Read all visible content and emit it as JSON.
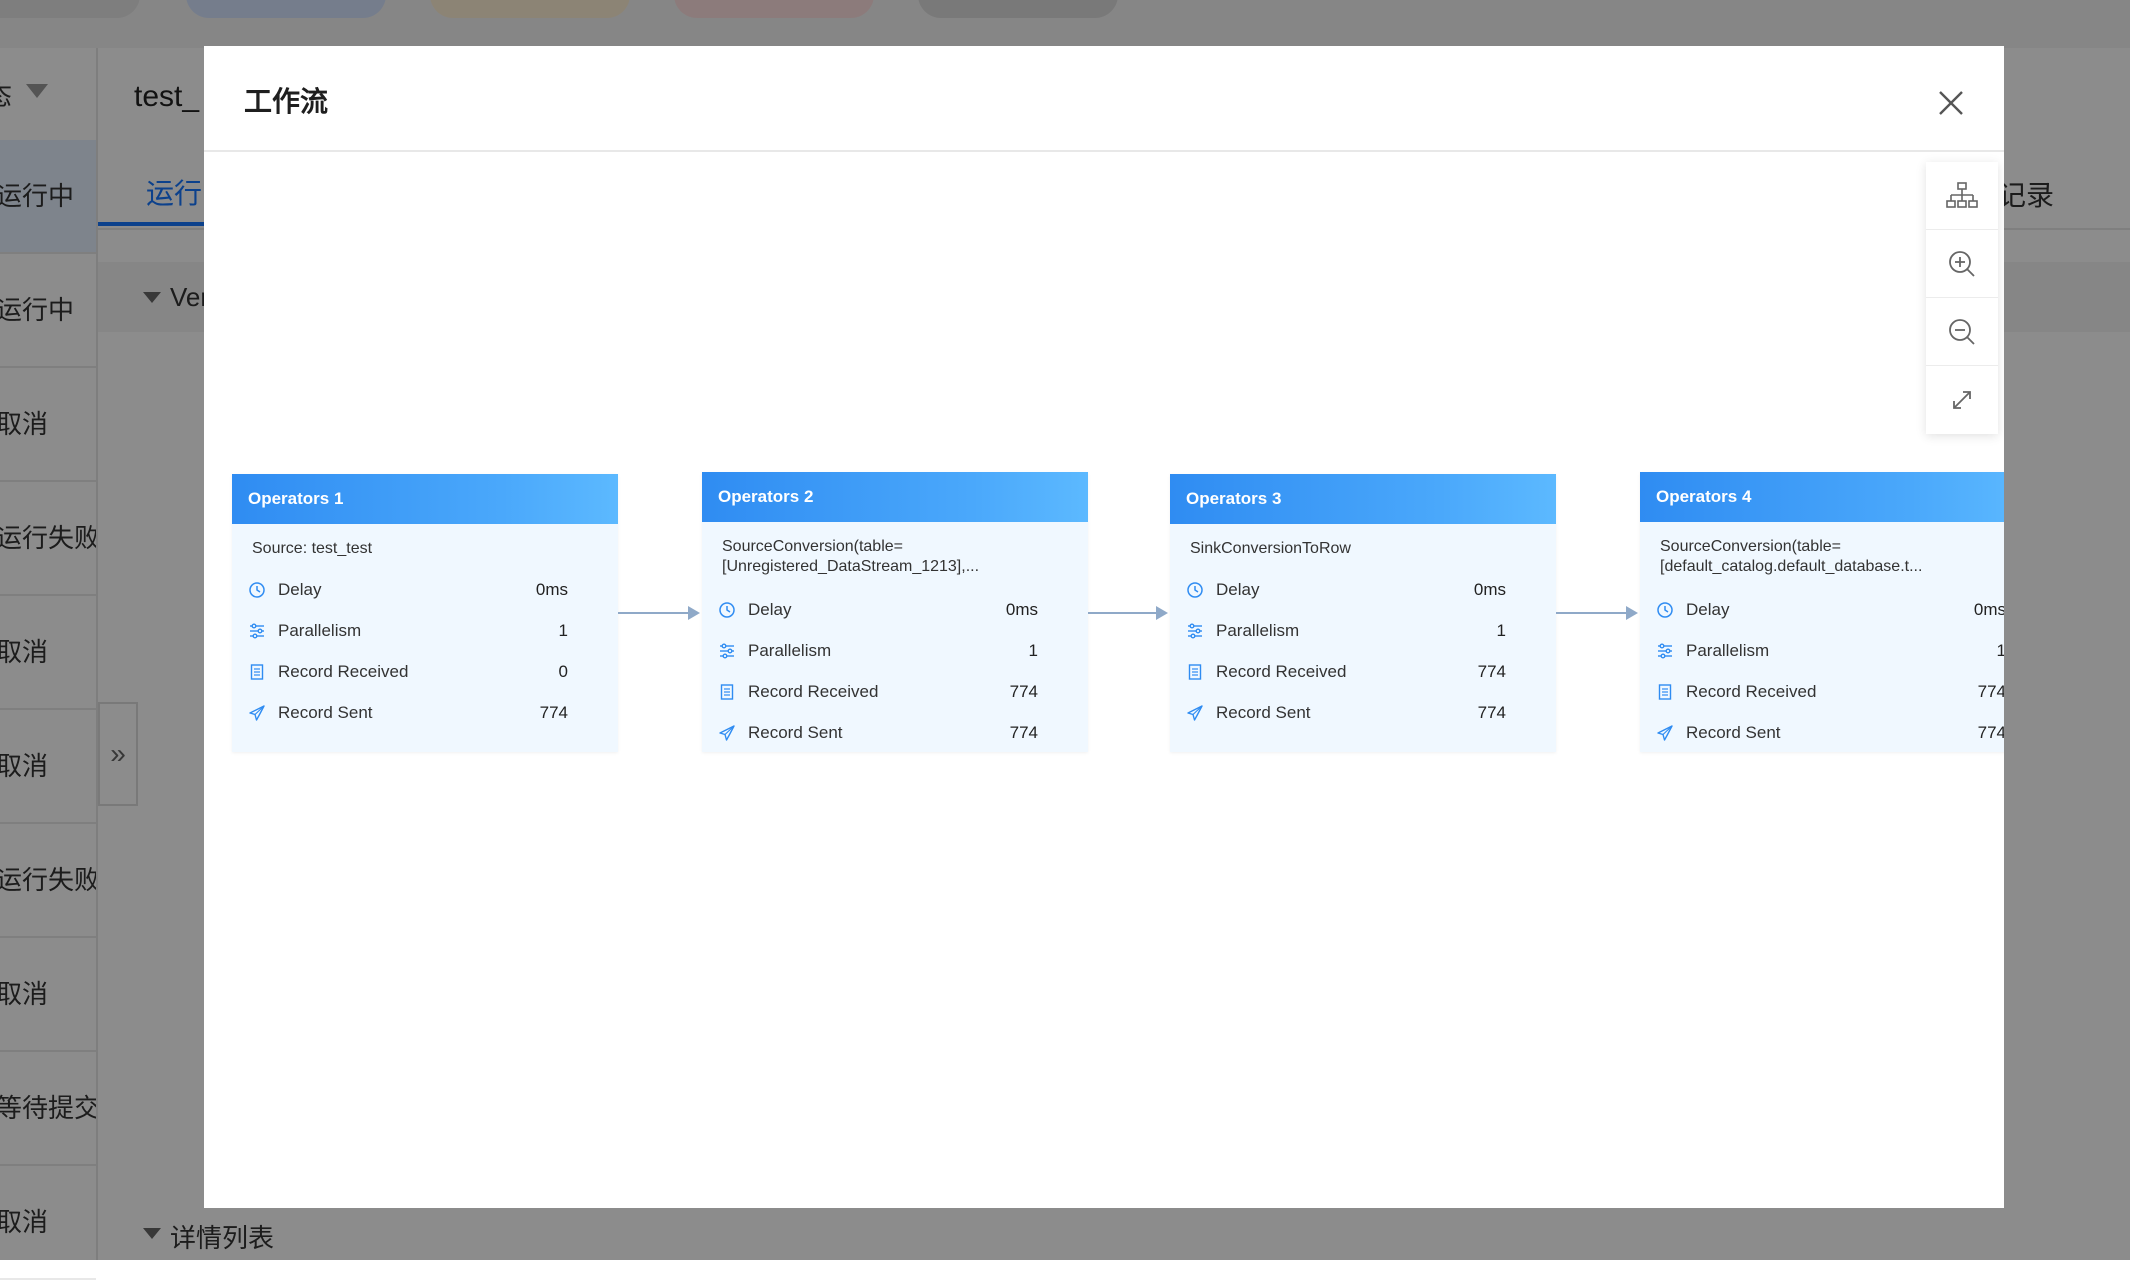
{
  "background": {
    "main_title": "test_",
    "active_tab": "运行",
    "right_tab": "记录",
    "section_label": "Ver",
    "bottom_section": "详情列表",
    "sidebar_head": "态",
    "sidebar_items": [
      {
        "label": "运行中"
      },
      {
        "label": "运行中"
      },
      {
        "label": "取消"
      },
      {
        "label": "运行失败"
      },
      {
        "label": "取消"
      },
      {
        "label": "取消"
      },
      {
        "label": "运行失败"
      },
      {
        "label": "取消"
      },
      {
        "label": "等待提交"
      },
      {
        "label": "取消"
      }
    ]
  },
  "modal": {
    "title": "工作流",
    "close_icon": "close-icon"
  },
  "toolbar": {
    "items": [
      "layout-tree-icon",
      "zoom-in-icon",
      "zoom-out-icon",
      "fullscreen-icon"
    ]
  },
  "nodes": [
    {
      "title": "Operators 1",
      "name_lines": [
        "Source: test_test"
      ],
      "metrics": [
        {
          "icon": "clock-icon",
          "label": "Delay",
          "value": "0ms"
        },
        {
          "icon": "parallelism-icon",
          "label": "Parallelism",
          "value": "1"
        },
        {
          "icon": "document-icon",
          "label": "Record Received",
          "value": "0"
        },
        {
          "icon": "send-icon",
          "label": "Record Sent",
          "value": "774"
        }
      ]
    },
    {
      "title": "Operators 2",
      "name_lines": [
        "SourceConversion(table=",
        "[Unregistered_DataStream_1213],..."
      ],
      "metrics": [
        {
          "icon": "clock-icon",
          "label": "Delay",
          "value": "0ms"
        },
        {
          "icon": "parallelism-icon",
          "label": "Parallelism",
          "value": "1"
        },
        {
          "icon": "document-icon",
          "label": "Record Received",
          "value": "774"
        },
        {
          "icon": "send-icon",
          "label": "Record Sent",
          "value": "774"
        }
      ]
    },
    {
      "title": "Operators 3",
      "name_lines": [
        "SinkConversionToRow"
      ],
      "metrics": [
        {
          "icon": "clock-icon",
          "label": "Delay",
          "value": "0ms"
        },
        {
          "icon": "parallelism-icon",
          "label": "Parallelism",
          "value": "1"
        },
        {
          "icon": "document-icon",
          "label": "Record Received",
          "value": "774"
        },
        {
          "icon": "send-icon",
          "label": "Record Sent",
          "value": "774"
        }
      ]
    },
    {
      "title": "Operators 4",
      "name_lines": [
        "SourceConversion(table=",
        "[default_catalog.default_database.t..."
      ],
      "metrics": [
        {
          "icon": "clock-icon",
          "label": "Delay",
          "value": "0ms"
        },
        {
          "icon": "parallelism-icon",
          "label": "Parallelism",
          "value": "1"
        },
        {
          "icon": "document-icon",
          "label": "Record Received",
          "value": "774"
        },
        {
          "icon": "send-icon",
          "label": "Record Sent",
          "value": "774"
        }
      ]
    }
  ],
  "colors": {
    "accent": "#1677ff",
    "node_header": "#2f8cf2",
    "node_body": "#f0f8ff",
    "edge": "#8fa9c8"
  }
}
